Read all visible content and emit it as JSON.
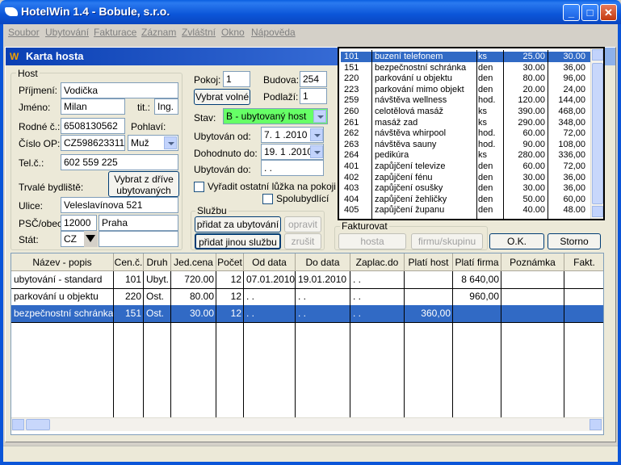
{
  "window": {
    "title": "HotelWin 1.4 - Bobule, s.r.o.",
    "min_icon": "minimize-icon",
    "max_icon": "maximize-icon",
    "close_icon": "close-icon",
    "min_glyph": "_",
    "max_glyph": "□",
    "close_glyph": "✕"
  },
  "menu": [
    "Soubor",
    "Ubytování",
    "Fakturace",
    "Záznam",
    "Zvláštní",
    "Okno",
    "Nápověda"
  ],
  "child": {
    "title": "Karta hosta",
    "icon_glyph": "W"
  },
  "host": {
    "group_label": "Host",
    "prijmeni_label": "Příjmení:",
    "prijmeni": "Vodička",
    "jmeno_label": "Jméno:",
    "jmeno": "Milan",
    "titul_label": "tit.:",
    "titul": "Ing.",
    "rodne_label": "Rodné č.:",
    "rodne": "6508130562",
    "pohlavi_label": "Pohlaví:",
    "cislo_op_label": "Číslo OP:",
    "cislo_op": "CZ598623311",
    "pohlavi": "Muž",
    "tel_label": "Tel.č.:",
    "tel": "602 559 225",
    "trvale_label": "Trvalé bydliště:",
    "vybrat_btn_line1": "Vybrat z dříve",
    "vybrat_btn_line2": "ubytovaných",
    "ulice_label": "Ulice:",
    "ulice": "Veleslavínova 521",
    "psc_label": "PSČ/obec",
    "psc": "12000",
    "obec": "Praha",
    "stat_label": "Stát:",
    "stat": "CZ",
    "stat_detail": ""
  },
  "room": {
    "pokoj_label": "Pokoj:",
    "pokoj": "1",
    "budova_label": "Budova:",
    "budova": "254",
    "vybrat_volne": "Vybrat volné",
    "podlazi_label": "Podlaží:",
    "podlazi": "1",
    "stav_label": "Stav:",
    "stav": "B - ubytovaný host",
    "stav_color": "#66ff66",
    "ubytovan_od_label": "Ubytován od:",
    "ubytovan_od": "7. 1 .2010",
    "dohodnuto_label": "Dohodnuto do:",
    "dohodnuto": "19. 1 .2010",
    "ubytovan_do_label": "Ubytován do:",
    "ubytovan_do": " . .",
    "vyradit_label": "Vyřadit ostatní lůžka na pokoji",
    "spolubydlici_label": "Spolubydlící"
  },
  "sluzby": {
    "group_label": "Službu",
    "pridat_za_ubytovani": "přidat za ubytování",
    "opravit": "opravit",
    "pridat_jinou": "přidat jinou službu",
    "zrusit": "zrušit"
  },
  "fakturovat": {
    "group_label": "Fakturovat",
    "hosta": "hosta",
    "firmu": "firmu/skupinu"
  },
  "ok_label": "O.K.",
  "storno_label": "Storno",
  "services_popup": [
    {
      "code": "101",
      "name": "buzení telefonem",
      "unit": "ks",
      "price": "25.00",
      "vat": "30.00",
      "selected": true
    },
    {
      "code": "151",
      "name": "bezpečnostní schránka",
      "unit": "den",
      "price": "30.00",
      "vat": "36,00"
    },
    {
      "code": "220",
      "name": "parkování u objektu",
      "unit": "den",
      "price": "80.00",
      "vat": "96,00"
    },
    {
      "code": "223",
      "name": "parkování mimo objekt",
      "unit": "den",
      "price": "20.00",
      "vat": "24,00"
    },
    {
      "code": "259",
      "name": "návštěva wellness",
      "unit": "hod.",
      "price": "120.00",
      "vat": "144,00"
    },
    {
      "code": "260",
      "name": "celotělová masáž",
      "unit": "ks",
      "price": "390.00",
      "vat": "468,00"
    },
    {
      "code": "261",
      "name": "masáž zad",
      "unit": "ks",
      "price": "290.00",
      "vat": "348,00"
    },
    {
      "code": "262",
      "name": "návštěva whirpool",
      "unit": "hod.",
      "price": "60.00",
      "vat": "72,00"
    },
    {
      "code": "263",
      "name": "návštěva sauny",
      "unit": "hod.",
      "price": "90.00",
      "vat": "108,00"
    },
    {
      "code": "264",
      "name": "pedikúra",
      "unit": "ks",
      "price": "280.00",
      "vat": "336,00"
    },
    {
      "code": "401",
      "name": "zapůjčení televize",
      "unit": "den",
      "price": "60.00",
      "vat": "72,00"
    },
    {
      "code": "402",
      "name": "zapůjčení fénu",
      "unit": "den",
      "price": "30.00",
      "vat": "36,00"
    },
    {
      "code": "403",
      "name": "zapůjčení osušky",
      "unit": "den",
      "price": "30.00",
      "vat": "36,00"
    },
    {
      "code": "404",
      "name": "zapůjčení žehličky",
      "unit": "den",
      "price": "50.00",
      "vat": "60,00"
    },
    {
      "code": "405",
      "name": "zapůjčení županu",
      "unit": "den",
      "price": "40.00",
      "vat": "48.00"
    }
  ],
  "table": {
    "headers": [
      "Název - popis",
      "Cen.č.",
      "Druh",
      "Jed.cena",
      "Počet",
      "Od data",
      "Do data",
      "Zaplac.do",
      "Platí host",
      "Platí firma",
      "Poznámka",
      "Fakt."
    ],
    "rows": [
      {
        "name": "ubytování - standard",
        "code": "101",
        "druh": "Ubyt.",
        "cena": "720.00",
        "pocet": "12",
        "od": "07.01.2010",
        "do": "19.01.2010",
        "zapl": " . .",
        "host": "",
        "firma": "8 640,00",
        "pozn": "",
        "fakt": ""
      },
      {
        "name": "parkování u objektu",
        "code": "220",
        "druh": "Ost.",
        "cena": "80.00",
        "pocet": "12",
        "od": " . .",
        "do": " . .",
        "zapl": " . .",
        "host": "",
        "firma": "960,00",
        "pozn": "",
        "fakt": ""
      },
      {
        "name": "bezpečnostní schránka",
        "code": "151",
        "druh": "Ost.",
        "cena": "30.00",
        "pocet": "12",
        "od": " . .",
        "do": " . .",
        "zapl": " . .",
        "host": "360,00",
        "firma": "",
        "pozn": "",
        "fakt": "",
        "selected": true
      }
    ]
  }
}
